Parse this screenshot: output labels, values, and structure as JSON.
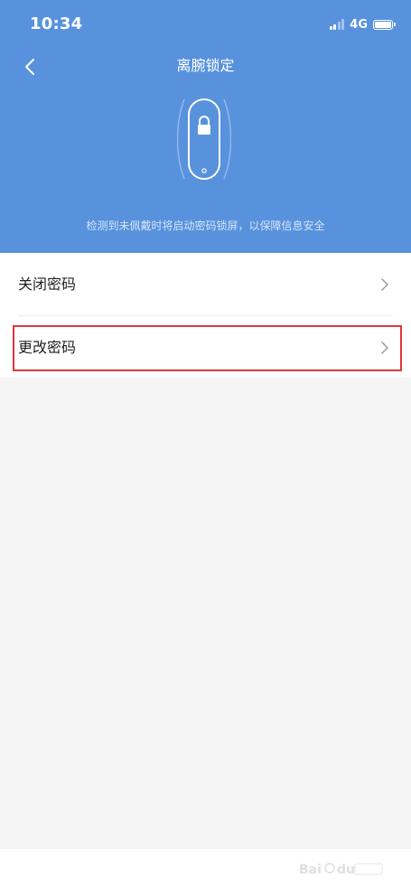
{
  "status_bar": {
    "time": "10:34",
    "network": "4G",
    "icons": [
      "signal-icon",
      "battery-icon"
    ]
  },
  "header": {
    "title": "离腕锁定",
    "description": "检测到未佩戴时将启动密码锁屏，以保障信息安全",
    "back_icon": "chevron-left-icon",
    "illustration_icon": "lock-icon",
    "background_color": "#5892dd"
  },
  "menu": {
    "items": [
      {
        "label": "关闭密码",
        "icon": "chevron-right-icon"
      },
      {
        "label": "更改密码",
        "icon": "chevron-right-icon",
        "highlighted": true
      }
    ],
    "highlight_color": "#e0353b"
  },
  "watermark": {
    "brand": "Baidu"
  }
}
